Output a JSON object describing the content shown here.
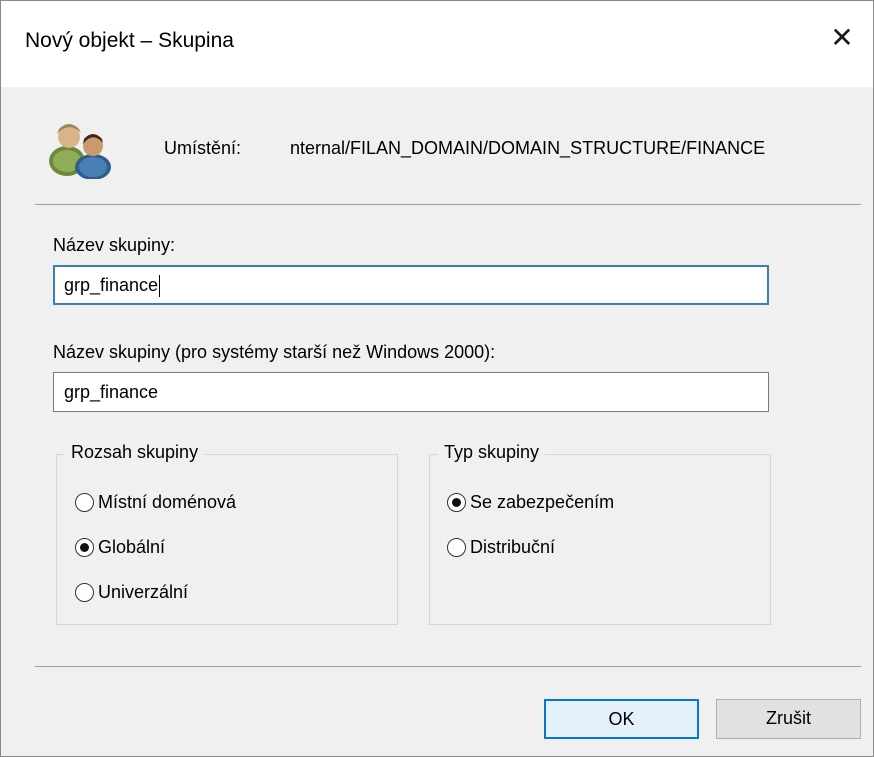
{
  "window": {
    "title": "Nový objekt – Skupina",
    "close_glyph": "✕"
  },
  "location": {
    "label": "Umístění:",
    "value": "nternal/FILAN_DOMAIN/DOMAIN_STRUCTURE/FINANCE"
  },
  "group_name": {
    "label": "Název skupiny:",
    "value": "grp_finance"
  },
  "group_name_legacy": {
    "label": "Název skupiny (pro systémy starší než Windows 2000):",
    "value": "grp_finance"
  },
  "scope": {
    "title": "Rozsah skupiny",
    "options": [
      {
        "label": "Místní doménová",
        "checked": false
      },
      {
        "label": "Globální",
        "checked": true
      },
      {
        "label": "Univerzální",
        "checked": false
      }
    ]
  },
  "type": {
    "title": "Typ skupiny",
    "options": [
      {
        "label": "Se zabezpečením",
        "checked": true
      },
      {
        "label": "Distribuční",
        "checked": false
      }
    ]
  },
  "buttons": {
    "ok": "OK",
    "cancel": "Zrušit"
  },
  "icons": {
    "group": "user-group-icon",
    "close": "close-icon"
  },
  "colors": {
    "dialog_bg": "#f0f0f0",
    "focus_border": "#3c7fb1",
    "default_button_border": "#0078d7"
  }
}
